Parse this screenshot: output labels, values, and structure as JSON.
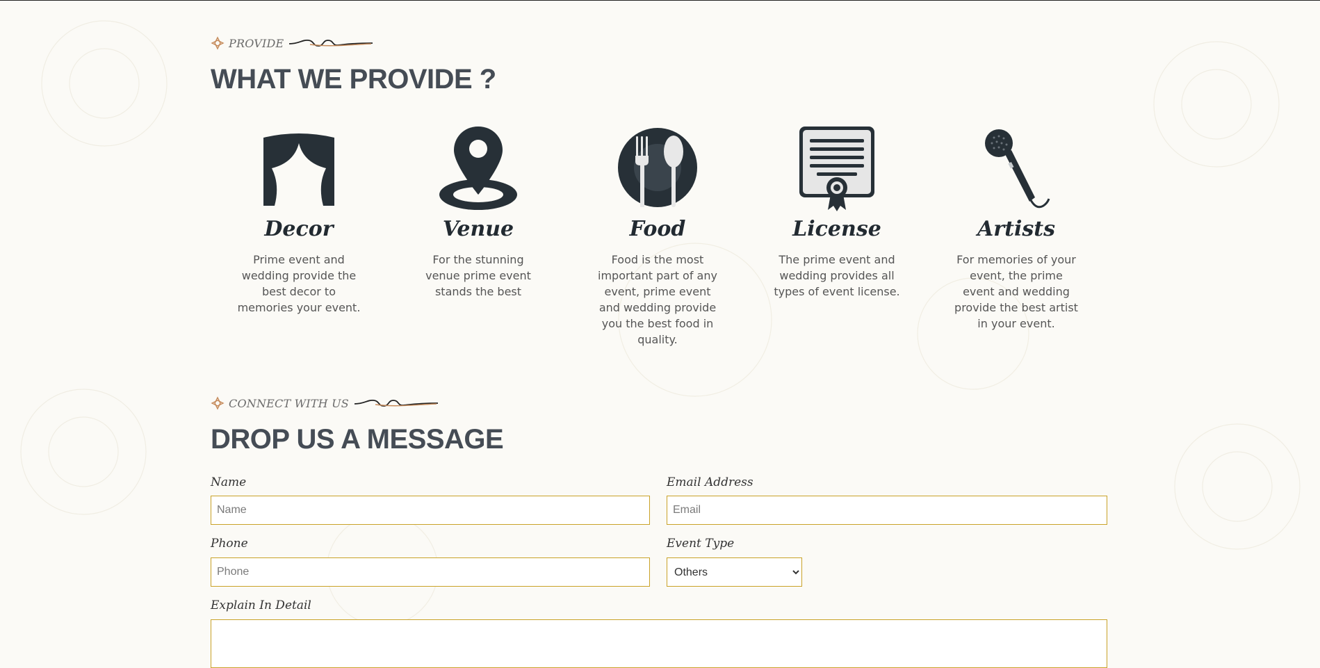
{
  "provide_section": {
    "eyebrow": "PROVIDE",
    "heading": "WHAT WE PROVIDE ?",
    "items": [
      {
        "icon": "curtain-icon",
        "title": "Decor",
        "description": "Prime event and wedding provide the best decor to memories your event."
      },
      {
        "icon": "location-pin-icon",
        "title": "Venue",
        "description": "For the stunning venue prime event stands the best"
      },
      {
        "icon": "fork-spoon-plate-icon",
        "title": "Food",
        "description": "Food is the most important part of any event, prime event and wedding provide you the best food in quality."
      },
      {
        "icon": "certificate-icon",
        "title": "License",
        "description": "The prime event and wedding provides all types of event license."
      },
      {
        "icon": "microphone-icon",
        "title": "Artists",
        "description": "For memories of your event, the prime event and wedding provide the best artist in your event."
      }
    ]
  },
  "contact_section": {
    "eyebrow": "CONNECT WITH US",
    "heading": "DROP US A MESSAGE",
    "form": {
      "name_label": "Name",
      "name_placeholder": "Name",
      "email_label": "Email Address",
      "email_placeholder": "Email",
      "phone_label": "Phone",
      "phone_placeholder": "Phone",
      "event_type_label": "Event Type",
      "event_type_selected": "Others",
      "detail_label": "Explain In Detail"
    }
  },
  "colors": {
    "icon_dark": "#273037",
    "heading": "#454c55",
    "field_border": "#c9a227",
    "ornament": "#c58a5a"
  }
}
